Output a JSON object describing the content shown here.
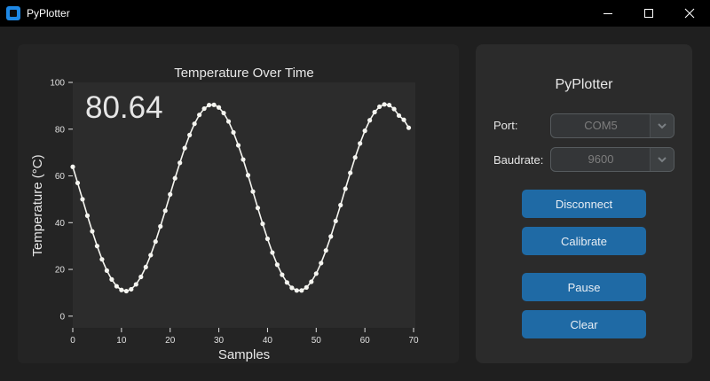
{
  "window": {
    "title": "PyPlotter",
    "icon": "app-window-icon"
  },
  "plot": {
    "current_value": "80.64",
    "chart_data": {
      "type": "line",
      "title": "Temperature Over Time",
      "xlabel": "Samples",
      "ylabel": "Temperature (°C)",
      "xlim": [
        0,
        70
      ],
      "ylim": [
        -5,
        100
      ],
      "xticks": [
        "0",
        "10",
        "20",
        "30",
        "40",
        "50",
        "60",
        "70"
      ],
      "yticks": [
        "0",
        "20",
        "40",
        "60",
        "80",
        "100"
      ],
      "grid": false,
      "line_color": "#f5f5f0",
      "marker": "circle",
      "x": [
        0,
        1,
        2,
        3,
        4,
        5,
        6,
        7,
        8,
        9,
        10,
        11,
        12,
        13,
        14,
        15,
        16,
        17,
        18,
        19,
        20,
        21,
        22,
        23,
        24,
        25,
        26,
        27,
        28,
        29,
        30,
        31,
        32,
        33,
        34,
        35,
        36,
        37,
        38,
        39,
        40,
        41,
        42,
        43,
        44,
        45,
        46,
        47,
        48,
        49,
        50,
        51,
        52,
        53,
        54,
        55,
        56,
        57,
        58,
        59,
        60,
        61,
        62,
        63,
        64,
        65,
        66,
        67,
        68,
        69
      ],
      "y": [
        63.9,
        57.0,
        50.0,
        43.0,
        36.3,
        30.0,
        24.3,
        19.5,
        15.7,
        12.8,
        11.2,
        10.7,
        11.5,
        13.6,
        16.8,
        21.0,
        26.1,
        31.9,
        38.4,
        45.1,
        52.1,
        59.0,
        65.6,
        71.9,
        77.5,
        82.3,
        86.1,
        88.8,
        90.3,
        90.4,
        89.3,
        86.9,
        83.3,
        78.6,
        73.1,
        67.0,
        60.3,
        53.3,
        46.3,
        39.5,
        33.1,
        27.2,
        22.0,
        17.7,
        14.4,
        12.1,
        11.0,
        11.0,
        12.3,
        14.7,
        18.2,
        22.7,
        28.1,
        34.1,
        40.7,
        47.5,
        54.5,
        61.3,
        67.9,
        73.9,
        79.3,
        83.8,
        87.3,
        89.6,
        90.6,
        90.3,
        88.6,
        85.8,
        84.0,
        80.6
      ]
    }
  },
  "controls": {
    "title": "PyPlotter",
    "port_label": "Port:",
    "port_value": "COM5",
    "baud_label": "Baudrate:",
    "baud_value": "9600",
    "disconnect_label": "Disconnect",
    "calibrate_label": "Calibrate",
    "pause_label": "Pause",
    "clear_label": "Clear",
    "accent_color": "#1f6aa5"
  }
}
